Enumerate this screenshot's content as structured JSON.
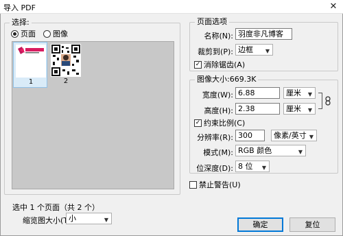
{
  "window": {
    "title": "导入 PDF",
    "close_glyph": "✕"
  },
  "select_group": {
    "legend": "选择:",
    "radio_page": "页面",
    "radio_image": "图像",
    "selected_radio": "页面",
    "thumbnails": [
      {
        "number": "1",
        "selected": true,
        "icon": "logo-page-thumbnail"
      },
      {
        "number": "2",
        "selected": false,
        "icon": "qr-code-thumbnail"
      }
    ],
    "status": "选中 1 个页面（共 2 个）",
    "thumb_size_label": "缩览图大小(T):",
    "thumb_size_value": "小"
  },
  "page_options": {
    "legend": "页面选项",
    "name_label": "名称(N):",
    "name_value": "羽度非凡博客",
    "crop_label": "裁剪到(P):",
    "crop_value": "边框",
    "antialias_label": "消除锯齿(A)",
    "antialias_checked": true
  },
  "image_size": {
    "legend": "图像大小:669.3K",
    "width_label": "宽度(W):",
    "width_value": "6.88",
    "width_unit": "厘米",
    "height_label": "高度(H):",
    "height_value": "2.38",
    "height_unit": "厘米",
    "constrain_label": "约束比例(C)",
    "constrain_checked": true,
    "resolution_label": "分辨率(R):",
    "resolution_value": "300",
    "resolution_unit": "像素/英寸",
    "mode_label": "模式(M):",
    "mode_value": "RGB 颜色",
    "depth_label": "位深度(D):",
    "depth_value": "8 位"
  },
  "suppress_warnings_label": "禁止警告(U)",
  "suppress_warnings_checked": false,
  "buttons": {
    "ok": "确定",
    "reset": "复位"
  }
}
